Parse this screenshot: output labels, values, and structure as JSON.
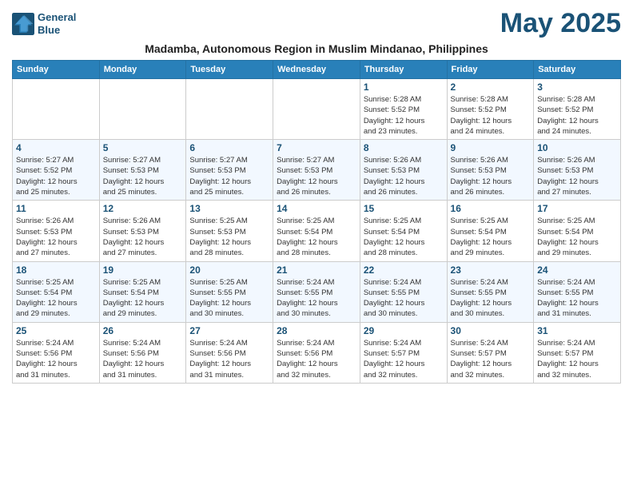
{
  "logo": {
    "line1": "General",
    "line2": "Blue"
  },
  "title": "May 2025",
  "subtitle": "Madamba, Autonomous Region in Muslim Mindanao, Philippines",
  "days_of_week": [
    "Sunday",
    "Monday",
    "Tuesday",
    "Wednesday",
    "Thursday",
    "Friday",
    "Saturday"
  ],
  "weeks": [
    [
      {
        "day": "",
        "info": ""
      },
      {
        "day": "",
        "info": ""
      },
      {
        "day": "",
        "info": ""
      },
      {
        "day": "",
        "info": ""
      },
      {
        "day": "1",
        "info": "Sunrise: 5:28 AM\nSunset: 5:52 PM\nDaylight: 12 hours\nand 23 minutes."
      },
      {
        "day": "2",
        "info": "Sunrise: 5:28 AM\nSunset: 5:52 PM\nDaylight: 12 hours\nand 24 minutes."
      },
      {
        "day": "3",
        "info": "Sunrise: 5:28 AM\nSunset: 5:52 PM\nDaylight: 12 hours\nand 24 minutes."
      }
    ],
    [
      {
        "day": "4",
        "info": "Sunrise: 5:27 AM\nSunset: 5:52 PM\nDaylight: 12 hours\nand 25 minutes."
      },
      {
        "day": "5",
        "info": "Sunrise: 5:27 AM\nSunset: 5:53 PM\nDaylight: 12 hours\nand 25 minutes."
      },
      {
        "day": "6",
        "info": "Sunrise: 5:27 AM\nSunset: 5:53 PM\nDaylight: 12 hours\nand 25 minutes."
      },
      {
        "day": "7",
        "info": "Sunrise: 5:27 AM\nSunset: 5:53 PM\nDaylight: 12 hours\nand 26 minutes."
      },
      {
        "day": "8",
        "info": "Sunrise: 5:26 AM\nSunset: 5:53 PM\nDaylight: 12 hours\nand 26 minutes."
      },
      {
        "day": "9",
        "info": "Sunrise: 5:26 AM\nSunset: 5:53 PM\nDaylight: 12 hours\nand 26 minutes."
      },
      {
        "day": "10",
        "info": "Sunrise: 5:26 AM\nSunset: 5:53 PM\nDaylight: 12 hours\nand 27 minutes."
      }
    ],
    [
      {
        "day": "11",
        "info": "Sunrise: 5:26 AM\nSunset: 5:53 PM\nDaylight: 12 hours\nand 27 minutes."
      },
      {
        "day": "12",
        "info": "Sunrise: 5:26 AM\nSunset: 5:53 PM\nDaylight: 12 hours\nand 27 minutes."
      },
      {
        "day": "13",
        "info": "Sunrise: 5:25 AM\nSunset: 5:53 PM\nDaylight: 12 hours\nand 28 minutes."
      },
      {
        "day": "14",
        "info": "Sunrise: 5:25 AM\nSunset: 5:54 PM\nDaylight: 12 hours\nand 28 minutes."
      },
      {
        "day": "15",
        "info": "Sunrise: 5:25 AM\nSunset: 5:54 PM\nDaylight: 12 hours\nand 28 minutes."
      },
      {
        "day": "16",
        "info": "Sunrise: 5:25 AM\nSunset: 5:54 PM\nDaylight: 12 hours\nand 29 minutes."
      },
      {
        "day": "17",
        "info": "Sunrise: 5:25 AM\nSunset: 5:54 PM\nDaylight: 12 hours\nand 29 minutes."
      }
    ],
    [
      {
        "day": "18",
        "info": "Sunrise: 5:25 AM\nSunset: 5:54 PM\nDaylight: 12 hours\nand 29 minutes."
      },
      {
        "day": "19",
        "info": "Sunrise: 5:25 AM\nSunset: 5:54 PM\nDaylight: 12 hours\nand 29 minutes."
      },
      {
        "day": "20",
        "info": "Sunrise: 5:25 AM\nSunset: 5:55 PM\nDaylight: 12 hours\nand 30 minutes."
      },
      {
        "day": "21",
        "info": "Sunrise: 5:24 AM\nSunset: 5:55 PM\nDaylight: 12 hours\nand 30 minutes."
      },
      {
        "day": "22",
        "info": "Sunrise: 5:24 AM\nSunset: 5:55 PM\nDaylight: 12 hours\nand 30 minutes."
      },
      {
        "day": "23",
        "info": "Sunrise: 5:24 AM\nSunset: 5:55 PM\nDaylight: 12 hours\nand 30 minutes."
      },
      {
        "day": "24",
        "info": "Sunrise: 5:24 AM\nSunset: 5:55 PM\nDaylight: 12 hours\nand 31 minutes."
      }
    ],
    [
      {
        "day": "25",
        "info": "Sunrise: 5:24 AM\nSunset: 5:56 PM\nDaylight: 12 hours\nand 31 minutes."
      },
      {
        "day": "26",
        "info": "Sunrise: 5:24 AM\nSunset: 5:56 PM\nDaylight: 12 hours\nand 31 minutes."
      },
      {
        "day": "27",
        "info": "Sunrise: 5:24 AM\nSunset: 5:56 PM\nDaylight: 12 hours\nand 31 minutes."
      },
      {
        "day": "28",
        "info": "Sunrise: 5:24 AM\nSunset: 5:56 PM\nDaylight: 12 hours\nand 32 minutes."
      },
      {
        "day": "29",
        "info": "Sunrise: 5:24 AM\nSunset: 5:57 PM\nDaylight: 12 hours\nand 32 minutes."
      },
      {
        "day": "30",
        "info": "Sunrise: 5:24 AM\nSunset: 5:57 PM\nDaylight: 12 hours\nand 32 minutes."
      },
      {
        "day": "31",
        "info": "Sunrise: 5:24 AM\nSunset: 5:57 PM\nDaylight: 12 hours\nand 32 minutes."
      }
    ]
  ]
}
